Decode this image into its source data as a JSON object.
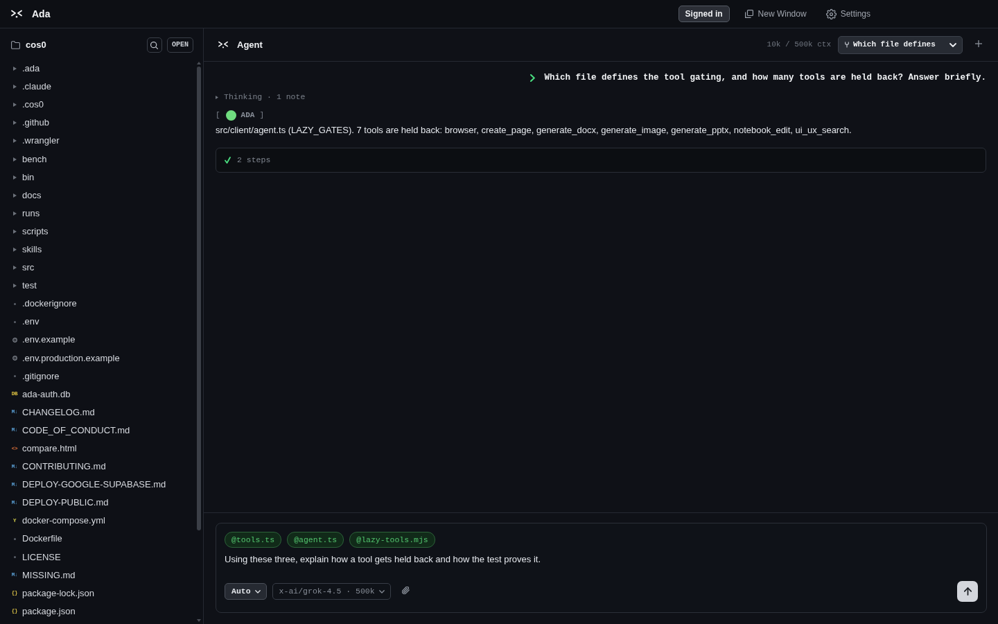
{
  "top_bar": {
    "app_name": "Ada",
    "account_button": "Signed in",
    "actions": [
      {
        "kind": "new_window",
        "label": "New Window"
      },
      {
        "kind": "settings",
        "label": "Settings"
      }
    ]
  },
  "sidebar": {
    "folder_name": "cos0",
    "open_button": "OPEN",
    "items": [
      {
        "name": ".ada",
        "kind": "folder"
      },
      {
        "name": ".claude",
        "kind": "folder"
      },
      {
        "name": ".cos0",
        "kind": "folder"
      },
      {
        "name": ".github",
        "kind": "folder"
      },
      {
        "name": ".wrangler",
        "kind": "folder"
      },
      {
        "name": "bench",
        "kind": "folder"
      },
      {
        "name": "bin",
        "kind": "folder"
      },
      {
        "name": "docs",
        "kind": "folder"
      },
      {
        "name": "runs",
        "kind": "folder"
      },
      {
        "name": "scripts",
        "kind": "folder"
      },
      {
        "name": "skills",
        "kind": "folder"
      },
      {
        "name": "src",
        "kind": "folder"
      },
      {
        "name": "test",
        "kind": "folder"
      },
      {
        "name": ".dockerignore",
        "kind": "plain"
      },
      {
        "name": ".env",
        "kind": "plain"
      },
      {
        "name": ".env.example",
        "kind": "config"
      },
      {
        "name": ".env.production.example",
        "kind": "config"
      },
      {
        "name": ".gitignore",
        "kind": "plain"
      },
      {
        "name": "ada-auth.db",
        "kind": "db",
        "badge": "DB"
      },
      {
        "name": "CHANGELOG.md",
        "kind": "markdown",
        "badge": "M↓"
      },
      {
        "name": "CODE_OF_CONDUCT.md",
        "kind": "markdown",
        "badge": "M↓"
      },
      {
        "name": "compare.html",
        "kind": "html",
        "badge": "<>"
      },
      {
        "name": "CONTRIBUTING.md",
        "kind": "markdown",
        "badge": "M↓"
      },
      {
        "name": "DEPLOY-GOOGLE-SUPABASE.md",
        "kind": "markdown",
        "badge": "M↓"
      },
      {
        "name": "DEPLOY-PUBLIC.md",
        "kind": "markdown",
        "badge": "M↓"
      },
      {
        "name": "docker-compose.yml",
        "kind": "yaml",
        "badge": "Y"
      },
      {
        "name": "Dockerfile",
        "kind": "plain"
      },
      {
        "name": "LICENSE",
        "kind": "plain"
      },
      {
        "name": "MISSING.md",
        "kind": "markdown",
        "badge": "M↓"
      },
      {
        "name": "package-lock.json",
        "kind": "json",
        "badge": "{}"
      },
      {
        "name": "package.json",
        "kind": "json",
        "badge": "{}"
      }
    ]
  },
  "agent_panel": {
    "title": "Agent",
    "context_usage": "10k / 500k ctx",
    "session_select": "Which file defines",
    "messages": [
      {
        "kind": "user",
        "text": "Which file defines the tool gating, and how many tools are held back? Answer briefly."
      },
      {
        "kind": "thinking",
        "text": "Thinking · 1 note"
      },
      {
        "kind": "agent",
        "tag": {
          "open": "[",
          "name": "ADA",
          "close": "]"
        },
        "text": "src/client/agent.ts (LAZY_GATES). 7 tools are held back: browser, create_page, generate_docx, generate_image, generate_pptx, notebook_edit, ui_ux_search."
      },
      {
        "kind": "steps",
        "text": "2 steps",
        "done": true
      }
    ],
    "composer": {
      "attachments": [
        "@tools.ts",
        "@agent.ts",
        "@lazy-tools.mjs"
      ],
      "text": "Using these three, explain how a tool gets held back and how the test proves it.",
      "mode_button": "Auto",
      "model_button": "x-ai/grok-4.5 · 500k"
    }
  }
}
